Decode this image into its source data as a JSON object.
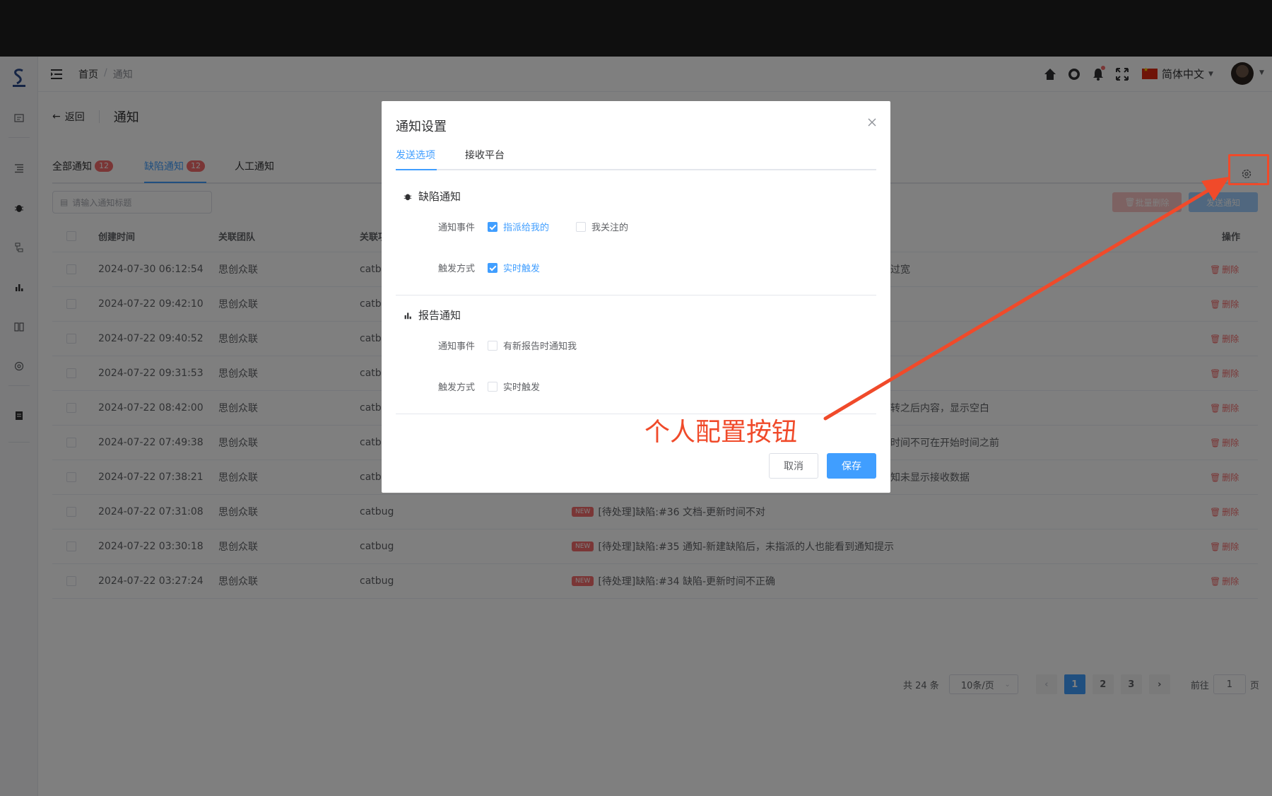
{
  "header": {
    "breadcrumb": [
      "首页",
      "通知"
    ],
    "breadcrumb_sep": "/",
    "language": "简体中文"
  },
  "page": {
    "back_label": "返回",
    "title": "通知"
  },
  "tabs": [
    {
      "label": "全部通知",
      "badge": "12"
    },
    {
      "label": "缺陷通知",
      "badge": "12"
    },
    {
      "label": "人工通知",
      "badge": ""
    }
  ],
  "search": {
    "placeholder": "请输入通知标题"
  },
  "actions": {
    "batch_delete": "批量删除",
    "send": "发送通知"
  },
  "table": {
    "headers": {
      "time": "创建时间",
      "team": "关联团队",
      "project": "关联项目",
      "op": "操作"
    },
    "rows": [
      {
        "time": "2024-07-30 06:12:54",
        "team": "思创众联",
        "project": "catbug",
        "content": "",
        "tail": "过宽",
        "new": false
      },
      {
        "time": "2024-07-22 09:42:10",
        "team": "思创众联",
        "project": "catbug",
        "content": "",
        "tail": "",
        "new": false
      },
      {
        "time": "2024-07-22 09:40:52",
        "team": "思创众联",
        "project": "catbug",
        "content": "",
        "tail": "",
        "new": false
      },
      {
        "time": "2024-07-22 09:31:53",
        "team": "思创众联",
        "project": "catbug",
        "content": "",
        "tail": "",
        "new": false
      },
      {
        "time": "2024-07-22 08:42:00",
        "team": "思创众联",
        "project": "catbug",
        "content": "",
        "tail": "转之后内容，显示空白",
        "new": false
      },
      {
        "time": "2024-07-22 07:49:38",
        "team": "思创众联",
        "project": "catbug",
        "content": "",
        "tail": "时间不可在开始时间之前",
        "new": false
      },
      {
        "time": "2024-07-22 07:38:21",
        "team": "思创众联",
        "project": "catbug",
        "content": "",
        "tail": "知未显示接收数据",
        "new": false
      },
      {
        "time": "2024-07-22 07:31:08",
        "team": "思创众联",
        "project": "catbug",
        "content": "[待处理]缺陷:#36 文档-更新时间不对",
        "tail": "",
        "new": true
      },
      {
        "time": "2024-07-22 03:30:18",
        "team": "思创众联",
        "project": "catbug",
        "content": "[待处理]缺陷:#35 通知-新建缺陷后，未指派的人也能看到通知提示",
        "tail": "",
        "new": true
      },
      {
        "time": "2024-07-22 03:27:24",
        "team": "思创众联",
        "project": "catbug",
        "content": "[待处理]缺陷:#34 缺陷-更新时间不正确",
        "tail": "",
        "new": true
      }
    ],
    "new_tag": "NEW",
    "delete_label": "删除"
  },
  "pagination": {
    "total": "共 24 条",
    "page_size": "10条/页",
    "pages": [
      "1",
      "2",
      "3"
    ],
    "current": "1",
    "jump_prefix": "前往",
    "jump_value": "1",
    "jump_suffix": "页"
  },
  "dialog": {
    "title": "通知设置",
    "tabs": [
      "发送选项",
      "接收平台"
    ],
    "defect_section": {
      "title": "缺陷通知",
      "event_label": "通知事件",
      "event_options": [
        {
          "label": "指派给我的",
          "checked": true
        },
        {
          "label": "我关注的",
          "checked": false
        }
      ],
      "trigger_label": "触发方式",
      "trigger_options": [
        {
          "label": "实时触发",
          "checked": true
        }
      ]
    },
    "report_section": {
      "title": "报告通知",
      "event_label": "通知事件",
      "event_options": [
        {
          "label": "有新报告时通知我",
          "checked": false
        }
      ],
      "trigger_label": "触发方式",
      "trigger_options": [
        {
          "label": "实时触发",
          "checked": false
        }
      ]
    },
    "cancel": "取消",
    "save": "保存"
  },
  "annotation": {
    "label": "个人配置按钮",
    "color": "#f04a2a"
  },
  "colors": {
    "primary": "#409eff",
    "danger": "#f56c6c"
  }
}
